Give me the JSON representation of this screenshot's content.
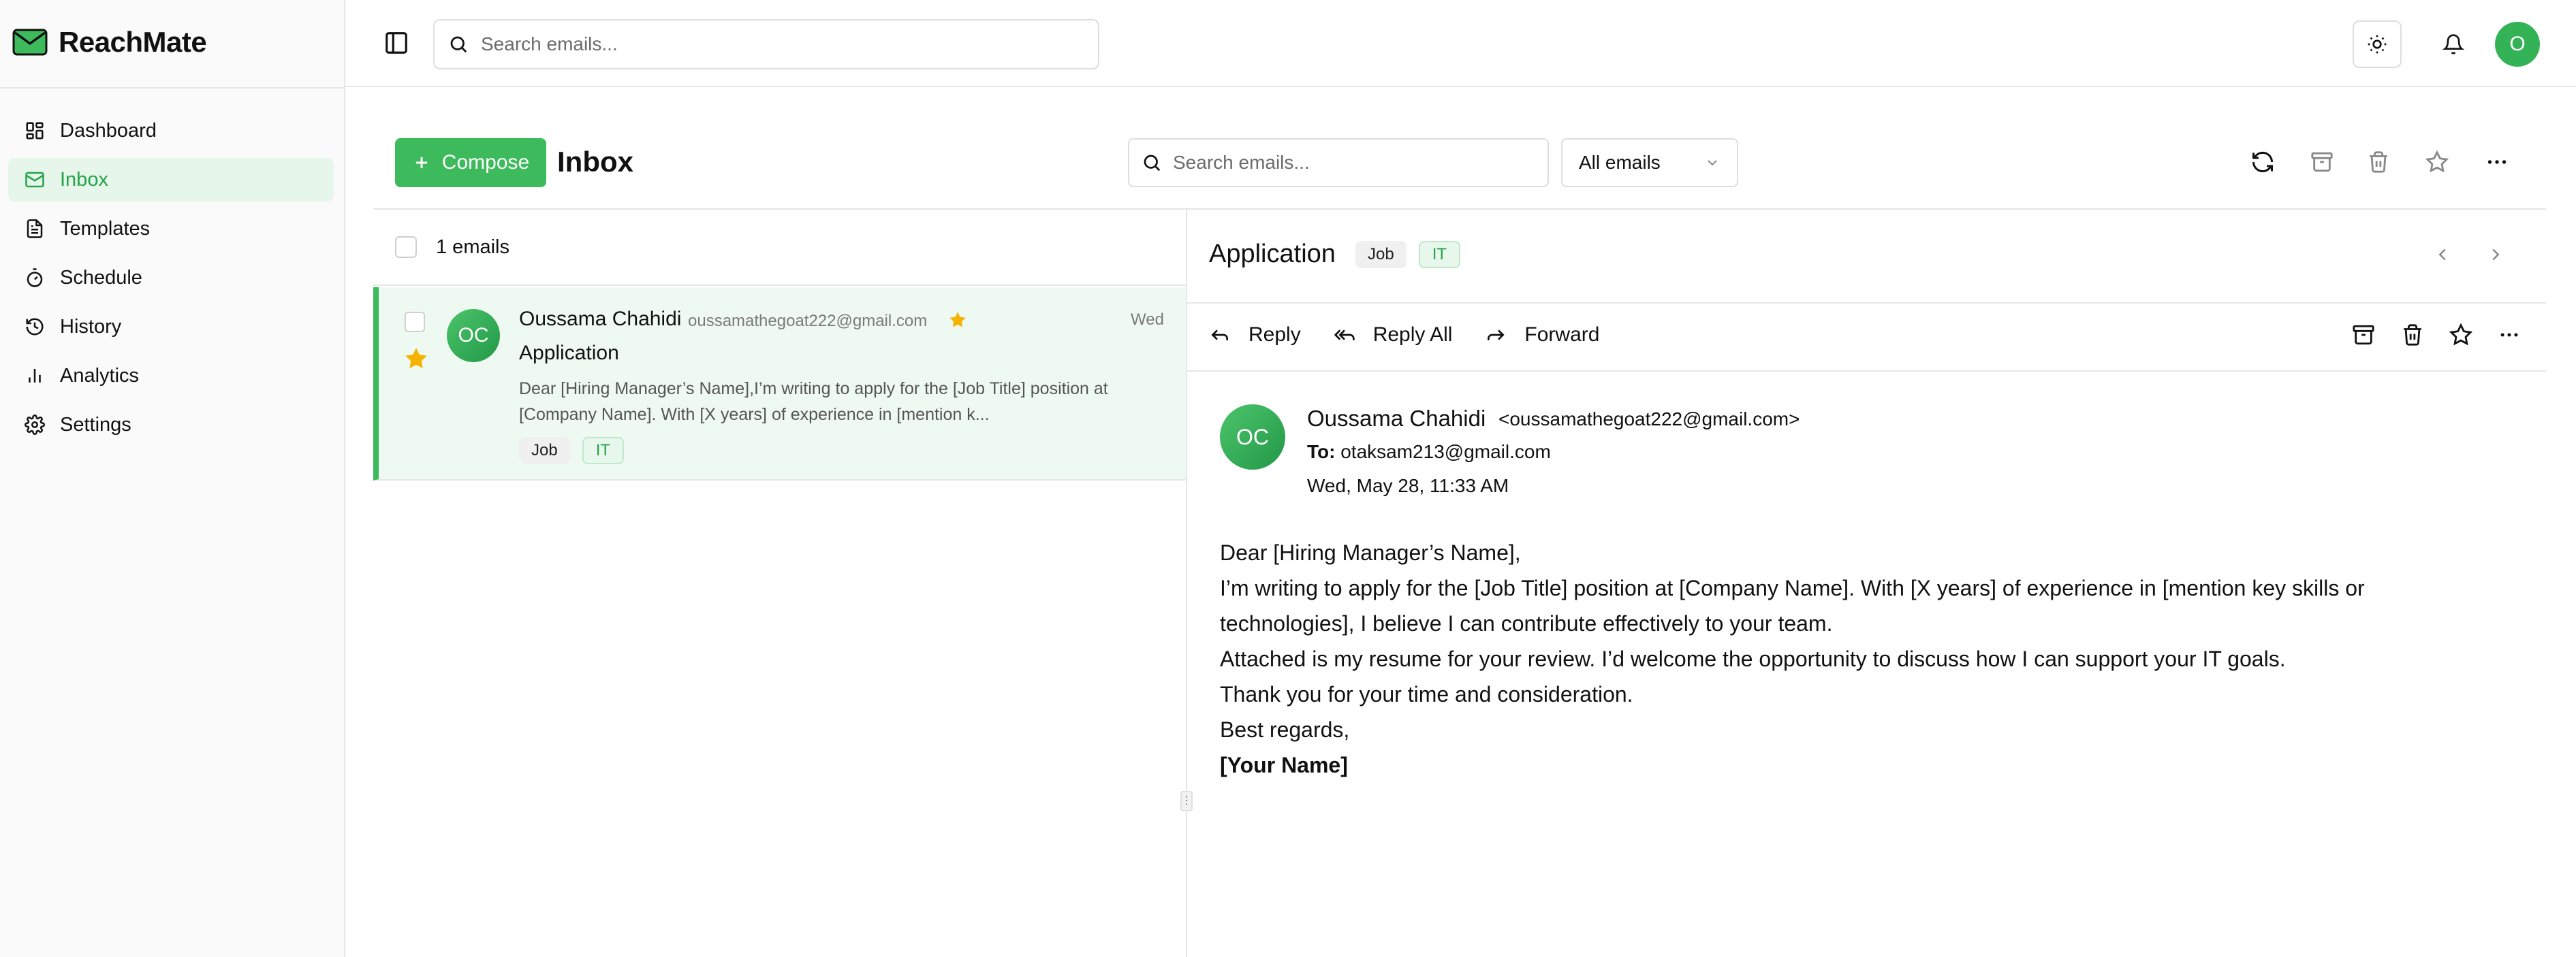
{
  "app": {
    "name": "ReachMate"
  },
  "sidebar": {
    "items": [
      {
        "label": "Dashboard",
        "icon": "dashboard-icon"
      },
      {
        "label": "Inbox",
        "icon": "mail-icon",
        "active": true
      },
      {
        "label": "Templates",
        "icon": "file-text-icon"
      },
      {
        "label": "Schedule",
        "icon": "timer-icon"
      },
      {
        "label": "History",
        "icon": "history-icon"
      },
      {
        "label": "Analytics",
        "icon": "bar-chart-icon"
      },
      {
        "label": "Settings",
        "icon": "gear-icon"
      }
    ]
  },
  "topbar": {
    "search_placeholder": "Search emails...",
    "user_initial": "O"
  },
  "inbox": {
    "compose_label": "Compose",
    "title": "Inbox",
    "search_placeholder": "Search emails...",
    "filter_selected": "All emails",
    "count_label": "1 emails"
  },
  "emails": [
    {
      "initials": "OC",
      "sender": "Oussama Chahidi",
      "sender_email": "oussamathegoat222@gmail.com",
      "date": "Wed",
      "subject": "Application",
      "preview": "Dear [Hiring Manager’s Name],I’m writing to apply for the [Job Title] position at [Company Name]. With [X years] of experience in [mention k...",
      "tags": [
        "Job",
        "IT"
      ],
      "starred": true
    }
  ],
  "detail": {
    "subject": "Application",
    "tags": [
      "Job",
      "IT"
    ],
    "actions": {
      "reply": "Reply",
      "reply_all": "Reply All",
      "forward": "Forward"
    },
    "initials": "OC",
    "sender": "Oussama Chahidi",
    "sender_email": "<oussamathegoat222@gmail.com>",
    "to_label": "To:",
    "to": "otaksam213@gmail.com",
    "date": "Wed, May 28, 11:33 AM",
    "body": [
      "Dear [Hiring Manager’s Name],",
      "I’m writing to apply for the [Job Title] position at [Company Name]. With [X years] of experience in [mention key skills or technologies], I believe I can contribute effectively to your team.",
      "Attached is my resume for your review. I’d welcome the opportunity to discuss how I can support your IT goals.",
      "Thank you for your time and consideration.",
      "Best regards,"
    ],
    "signature": "[Your Name]"
  },
  "colors": {
    "accent": "#3cba5c",
    "accent_text": "#22a447",
    "active_bg": "#e6f6ea",
    "star": "#f5b301"
  }
}
